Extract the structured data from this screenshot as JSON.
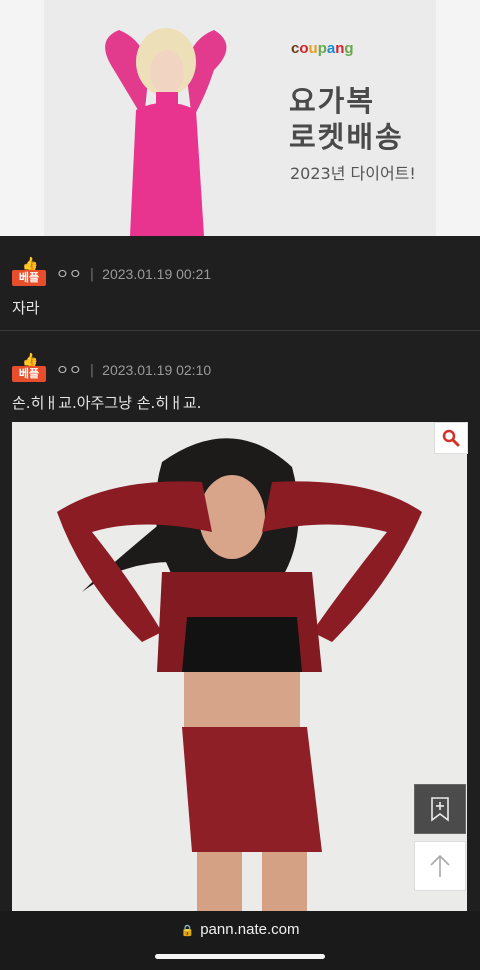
{
  "ad": {
    "brand": [
      "c",
      "o",
      "u",
      "p",
      "a",
      "n",
      "g"
    ],
    "line1": "요가복",
    "line2": "로켓배송",
    "line3": "2023년 다이어트!"
  },
  "comments": [
    {
      "badge": "베플",
      "author": "ㅇㅇ",
      "separator": "|",
      "date": "2023.01.19 00:21",
      "text": "자라"
    },
    {
      "badge": "베플",
      "author": "ㅇㅇ",
      "separator": "|",
      "date": "2023.01.19 02:10",
      "text": "손.히ㅐ교.아주그냥 손.히ㅐ교."
    }
  ],
  "browser": {
    "url": "pann.nate.com"
  },
  "icons": {
    "thumb": "thumbs-up-icon",
    "zoom": "magnifier-icon",
    "bookmark": "bookmark-add-icon",
    "top": "arrow-up-icon",
    "lock": "lock-icon"
  },
  "colors": {
    "badge": "#e84d2c",
    "background": "#1f1f1f"
  }
}
